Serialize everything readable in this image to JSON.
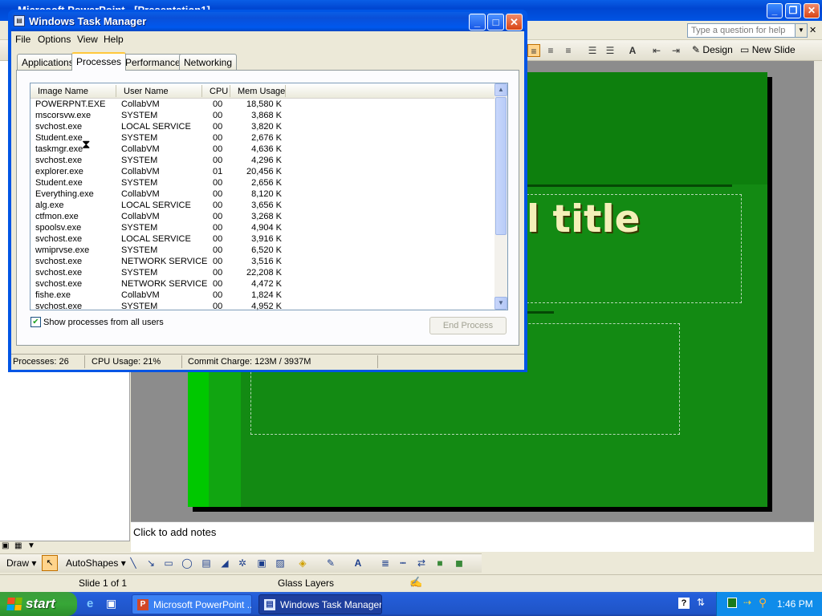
{
  "powerpoint": {
    "title": "Microsoft PowerPoint - [Presentation1]",
    "help_placeholder": "Type a question for help",
    "design_label": "Design",
    "new_slide_label": "New Slide",
    "slide_title_fragment": "l title",
    "notes_placeholder": "Click to add notes",
    "draw_label": "Draw",
    "autoshapes_label": "AutoShapes",
    "status_slide": "Slide 1 of 1",
    "status_template": "Glass Layers"
  },
  "task_manager": {
    "title": "Windows Task Manager",
    "menu": [
      "File",
      "Options",
      "View",
      "Help"
    ],
    "tabs": [
      "Applications",
      "Processes",
      "Performance",
      "Networking"
    ],
    "active_tab": "Processes",
    "columns": [
      "Image Name",
      "User Name",
      "CPU",
      "Mem Usage"
    ],
    "processes": [
      {
        "image": "POWERPNT.EXE",
        "user": "CollabVM",
        "cpu": "00",
        "mem": "18,580 K"
      },
      {
        "image": "mscorsvw.exe",
        "user": "SYSTEM",
        "cpu": "00",
        "mem": "3,868 K"
      },
      {
        "image": "svchost.exe",
        "user": "LOCAL SERVICE",
        "cpu": "00",
        "mem": "3,820 K"
      },
      {
        "image": "Student.exe",
        "user": "SYSTEM",
        "cpu": "00",
        "mem": "2,676 K"
      },
      {
        "image": "taskmgr.exe",
        "user": "CollabVM",
        "cpu": "00",
        "mem": "4,636 K"
      },
      {
        "image": "svchost.exe",
        "user": "SYSTEM",
        "cpu": "00",
        "mem": "4,296 K"
      },
      {
        "image": "explorer.exe",
        "user": "CollabVM",
        "cpu": "01",
        "mem": "20,456 K"
      },
      {
        "image": "Student.exe",
        "user": "SYSTEM",
        "cpu": "00",
        "mem": "2,656 K"
      },
      {
        "image": "Everything.exe",
        "user": "CollabVM",
        "cpu": "00",
        "mem": "8,120 K"
      },
      {
        "image": "alg.exe",
        "user": "LOCAL SERVICE",
        "cpu": "00",
        "mem": "3,656 K"
      },
      {
        "image": "ctfmon.exe",
        "user": "CollabVM",
        "cpu": "00",
        "mem": "3,268 K"
      },
      {
        "image": "spoolsv.exe",
        "user": "SYSTEM",
        "cpu": "00",
        "mem": "4,904 K"
      },
      {
        "image": "svchost.exe",
        "user": "LOCAL SERVICE",
        "cpu": "00",
        "mem": "3,916 K"
      },
      {
        "image": "wmiprvse.exe",
        "user": "SYSTEM",
        "cpu": "00",
        "mem": "6,520 K"
      },
      {
        "image": "svchost.exe",
        "user": "NETWORK SERVICE",
        "cpu": "00",
        "mem": "3,516 K"
      },
      {
        "image": "svchost.exe",
        "user": "SYSTEM",
        "cpu": "00",
        "mem": "22,208 K"
      },
      {
        "image": "svchost.exe",
        "user": "NETWORK SERVICE",
        "cpu": "00",
        "mem": "4,472 K"
      },
      {
        "image": "fishe.exe",
        "user": "CollabVM",
        "cpu": "00",
        "mem": "1,824 K"
      },
      {
        "image": "svchost.exe",
        "user": "SYSTEM",
        "cpu": "00",
        "mem": "4,952 K"
      }
    ],
    "show_all_users_label": "Show processes from all users",
    "show_all_users_checked": true,
    "end_process_label": "End Process",
    "status": {
      "processes": "Processes: 26",
      "cpu": "CPU Usage: 21%",
      "commit": "Commit Charge: 123M / 3937M"
    }
  },
  "taskbar": {
    "start_label": "start",
    "tasks": [
      {
        "label": "Microsoft PowerPoint ...",
        "icon": "powerpoint-icon"
      },
      {
        "label": "Windows Task Manager",
        "icon": "task-manager-icon"
      }
    ],
    "clock": "1:46 PM"
  },
  "colors": {
    "xp_blue": "#0054e3",
    "slide_green": "#138a13",
    "title_text": "#f3f0b8",
    "start_green": "#37a737"
  }
}
